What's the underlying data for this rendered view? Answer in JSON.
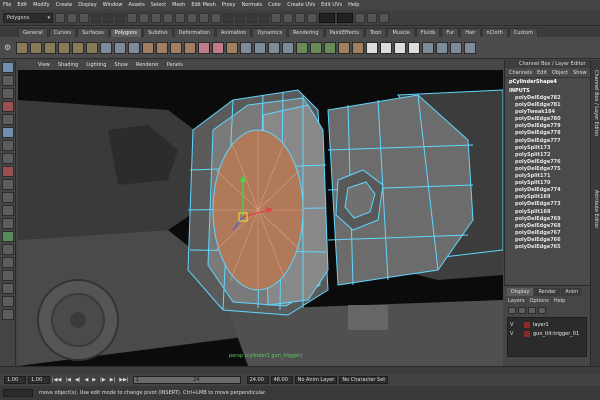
{
  "menubar": {
    "items": [
      "File",
      "Edit",
      "Modify",
      "Create",
      "Display",
      "Window",
      "Assets",
      "Select",
      "Mesh",
      "Edit Mesh",
      "Proxy",
      "Normals",
      "Color",
      "Create UVs",
      "Edit UVs",
      "Help"
    ]
  },
  "statusline": {
    "mode": "Polygons"
  },
  "shelf": {
    "tabs": [
      "General",
      "Curves",
      "Surfaces",
      "Polygons",
      "Subdivs",
      "Deformation",
      "Animation",
      "Dynamics",
      "Rendering",
      "PaintEffects",
      "Toon",
      "Muscle",
      "Fluids",
      "Fur",
      "Hair",
      "nCloth",
      "Custom"
    ],
    "active_tab": "Polygons"
  },
  "viewport": {
    "menu": [
      "View",
      "Shading",
      "Lighting",
      "Show",
      "Renderer",
      "Panels"
    ],
    "hud_label": "persp (cylinder1 gun_trigger)"
  },
  "channelbox": {
    "title": "Channel Box / Layer Editor",
    "menu": [
      "Channels",
      "Edit",
      "Object",
      "Show"
    ],
    "object_name": "pCylinderShape4",
    "inputs_label": "INPUTS",
    "nodes": [
      "polyDelEdge782",
      "polyDelEdge781",
      "polyTweak184",
      "polyDelEdge780",
      "polyDelEdge779",
      "polyDelEdge778",
      "polyDelEdge777",
      "polySplit173",
      "polySplit172",
      "polyDelEdge776",
      "polyDelEdge775",
      "polySplit171",
      "polySplit170",
      "polyDelEdge774",
      "polySplit169",
      "polyDelEdge773",
      "polySplit168",
      "polyDelEdge769",
      "polyDelEdge768",
      "polyDelEdge767",
      "polyDelEdge766",
      "polyDelEdge765"
    ]
  },
  "sidetab": {
    "label_1": "Channel Box / Layer Editor",
    "label_2": "Attribute Editor"
  },
  "layereditor": {
    "tabs": [
      "Display",
      "Render",
      "Anim"
    ],
    "active_tab": "Display",
    "menu": [
      "Layers",
      "Options",
      "Help"
    ],
    "layers": [
      {
        "visible": "V",
        "name": "layer1"
      },
      {
        "visible": "V",
        "name": "gun_tilt:trigger_01"
      }
    ]
  },
  "rangebar": {
    "start": "1.00",
    "current": "1.00",
    "slider_low": "1",
    "slider_high": "24",
    "end_field": "24.00",
    "max_field": "48.00",
    "anim_layer": "No Anim Layer",
    "char_set": "No Character Set",
    "playback": [
      "|◀◀",
      "|◀",
      "◀|",
      "◀",
      "▶",
      "|▶",
      "▶|",
      "▶▶|"
    ]
  },
  "helpline": {
    "text": "move object(s). Use edit mode to change pivot (INSERT). Ctrl+LMB to move perpendicular."
  },
  "colors": {
    "wire_cyan": "#5fd7ff",
    "face_orange": "#b07a5a",
    "hud_green": "#5fcf5f"
  }
}
